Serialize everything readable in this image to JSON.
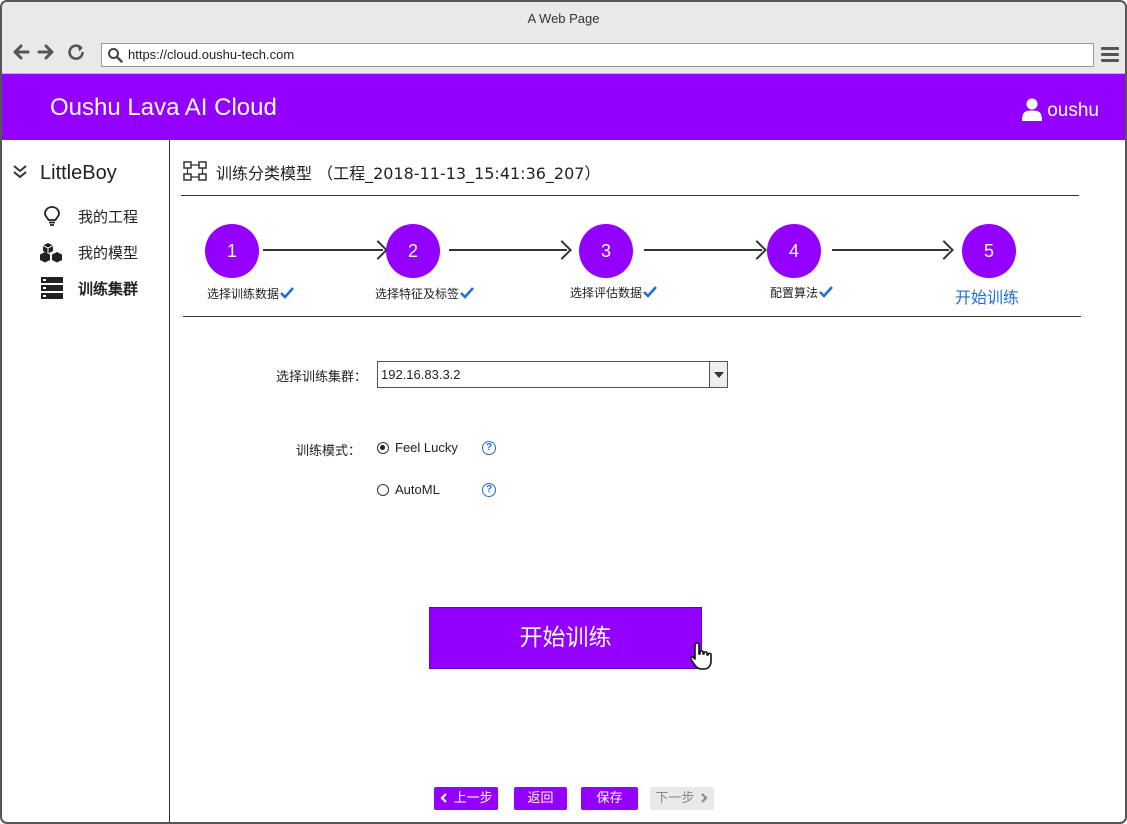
{
  "browser": {
    "window_title": "A Web Page",
    "url": "https://cloud.oushu-tech.com"
  },
  "header": {
    "brand": "Oushu Lava AI Cloud",
    "username": "oushu",
    "background_color": "#9400ff"
  },
  "sidebar": {
    "title": "LittleBoy",
    "items": [
      {
        "label": "我的工程",
        "icon": "lightbulb-icon"
      },
      {
        "label": "我的模型",
        "icon": "cubes-icon"
      },
      {
        "label": "训练集群",
        "icon": "server-icon"
      }
    ]
  },
  "page": {
    "title": "训练分类模型 （工程_2018-11-13_15:41:36_207）"
  },
  "steps": [
    {
      "number": "1",
      "label": "选择训练数据",
      "completed": true
    },
    {
      "number": "2",
      "label": "选择特征及标签",
      "completed": true
    },
    {
      "number": "3",
      "label": "选择评估数据",
      "completed": true
    },
    {
      "number": "4",
      "label": "配置算法",
      "completed": true
    },
    {
      "number": "5",
      "label": "开始训练",
      "completed": false,
      "active": true
    }
  ],
  "form": {
    "cluster_label": "选择训练集群：",
    "cluster_value": "192.16.83.3.2",
    "mode_label": "训练模式：",
    "modes": [
      {
        "label": "Feel Lucky",
        "selected": true
      },
      {
        "label": "AutoML",
        "selected": false
      }
    ],
    "help_glyph": "?"
  },
  "actions": {
    "start_label": "开始训练",
    "prev_label": "上一步",
    "back_label": "返回",
    "save_label": "保存",
    "next_label": "下一步"
  },
  "colors": {
    "accent": "#9400ff",
    "link": "#1f6fd6"
  }
}
